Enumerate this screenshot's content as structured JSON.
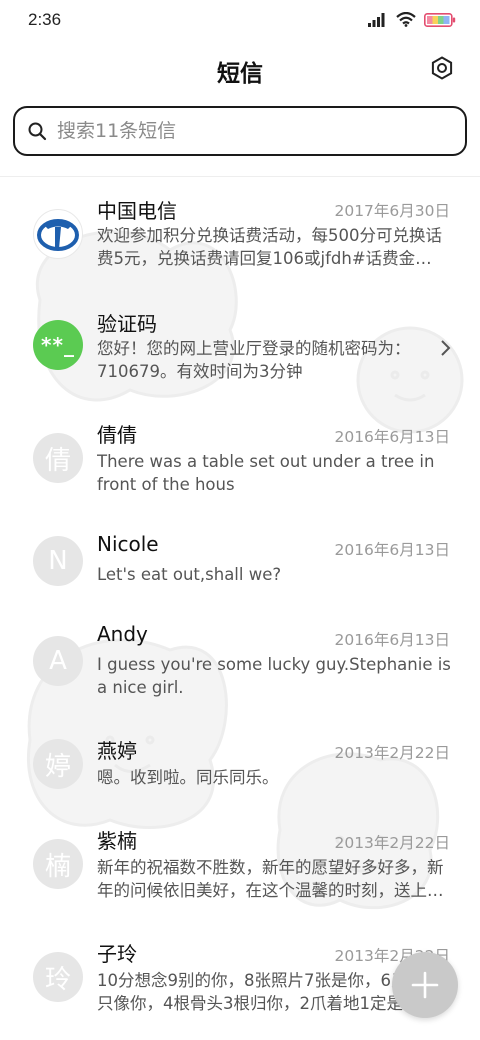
{
  "status_bar": {
    "time": "2:36"
  },
  "header": {
    "title": "短信"
  },
  "search": {
    "placeholder": "搜索11条短信"
  },
  "messages": [
    {
      "avatar_type": "telecom-logo",
      "sender": "中国电信",
      "date": "2017年6月30日",
      "preview": "欢迎参加积分兑换话费活动，每500分可兑换话费5元，兑换话费请回复106或jfdh#话费金…"
    },
    {
      "avatar_type": "code",
      "avatar_text": "**_",
      "sender": "验证码",
      "date": "",
      "preview": "您好！您的网上营业厅登录的随机密码为：710679。有效时间为3分钟",
      "has_chevron": true
    },
    {
      "avatar_type": "letter",
      "avatar_text": "倩",
      "sender": "倩倩",
      "date": "2016年6月13日",
      "preview": "There was a table set out under a tree in front of the hous"
    },
    {
      "avatar_type": "letter",
      "avatar_text": "N",
      "sender": "Nicole",
      "date": "2016年6月13日",
      "preview": "Let's eat out,shall we?"
    },
    {
      "avatar_type": "letter",
      "avatar_text": "A",
      "sender": "Andy",
      "date": "2016年6月13日",
      "preview": "I guess you're some lucky guy.Stephanie is a nice girl."
    },
    {
      "avatar_type": "letter",
      "avatar_text": "婷",
      "sender": "燕婷",
      "date": "2013年2月22日",
      "preview": "嗯。收到啦。同乐同乐。"
    },
    {
      "avatar_type": "letter",
      "avatar_text": "楠",
      "sender": "紫楠",
      "date": "2013年2月22日",
      "preview": "新年的祝福数不胜数，新年的愿望好多好多，新年的问候依旧美好，在这个温馨的时刻，送上…"
    },
    {
      "avatar_type": "letter",
      "avatar_text": "玲",
      "sender": "子玲",
      "date": "2013年2月22日",
      "preview": "10分想念9别的你，8张照片7张是你，6只小羊只像你，4根骨头3根归你，2爪着地1定是你"
    }
  ],
  "colors": {
    "accent_green": "#5bcb52",
    "telecom_blue": "#1e5fae",
    "avatar_gray": "#e6e6e6",
    "fab_gray": "#c9c9c9"
  },
  "icons": {
    "settings": "gear-icon",
    "search": "search-icon",
    "compose": "plus-icon",
    "chevron": "chevron-right-icon"
  }
}
